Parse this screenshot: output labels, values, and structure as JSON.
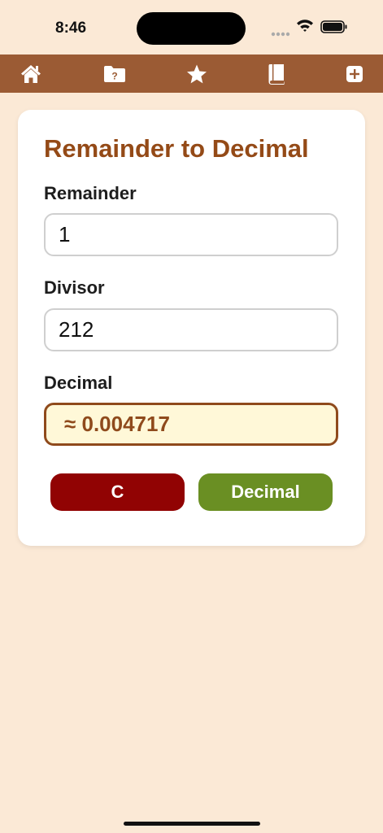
{
  "status": {
    "time": "8:46"
  },
  "toolbar": {
    "icons": [
      "home-icon",
      "folder-question-icon",
      "star-icon",
      "book-icon",
      "plus-icon"
    ],
    "folder_badge": "?"
  },
  "calculator": {
    "title": "Remainder to Decimal",
    "remainder_label": "Remainder",
    "remainder_value": "1",
    "divisor_label": "Divisor",
    "divisor_value": "212",
    "decimal_label": "Decimal",
    "decimal_value": "≈ 0.004717",
    "clear_label": "C",
    "decimal_button_label": "Decimal"
  },
  "colors": {
    "background": "#fbe9d6",
    "toolbar": "#9b5b34",
    "title": "#944a17",
    "clear_button": "#910303",
    "decimal_button": "#6a8f23",
    "result_border": "#8f4a1c",
    "result_fill": "#fff8d8"
  }
}
